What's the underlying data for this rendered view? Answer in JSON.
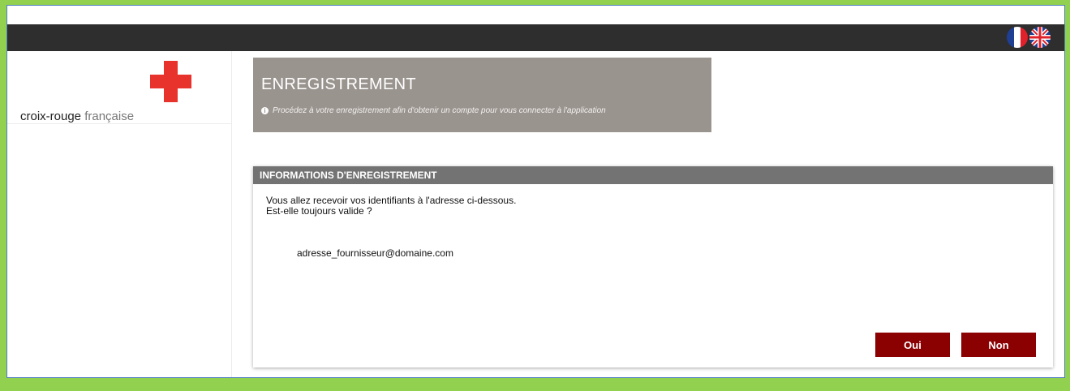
{
  "app": {
    "logo_word1": "croix-rouge",
    "logo_word2": "française",
    "flags": [
      {
        "name": "france-flag-icon"
      },
      {
        "name": "uk-flag-icon"
      }
    ]
  },
  "header": {
    "title": "ENREGISTREMENT",
    "subtitle": "Procédez à votre enregistrement afin d'obtenir un compte pour vous connecter à l'application",
    "info_icon_glyph": "i"
  },
  "card": {
    "title": "INFORMATIONS D'ENREGISTREMENT",
    "line1": "Vous allez recevoir vos identifiants à l'adresse ci-dessous.",
    "line2": "Est-elle toujours valide ?",
    "email": "adresse_fournisseur@domaine.com"
  },
  "buttons": {
    "oui_label": "Oui",
    "non_label": "Non"
  },
  "colors": {
    "background": "#92d050",
    "topbar": "#2e2e2e",
    "header_panel": "#9a948f",
    "card_header": "#737373",
    "button": "#8b0000",
    "logo_cross": "#e8322c"
  }
}
